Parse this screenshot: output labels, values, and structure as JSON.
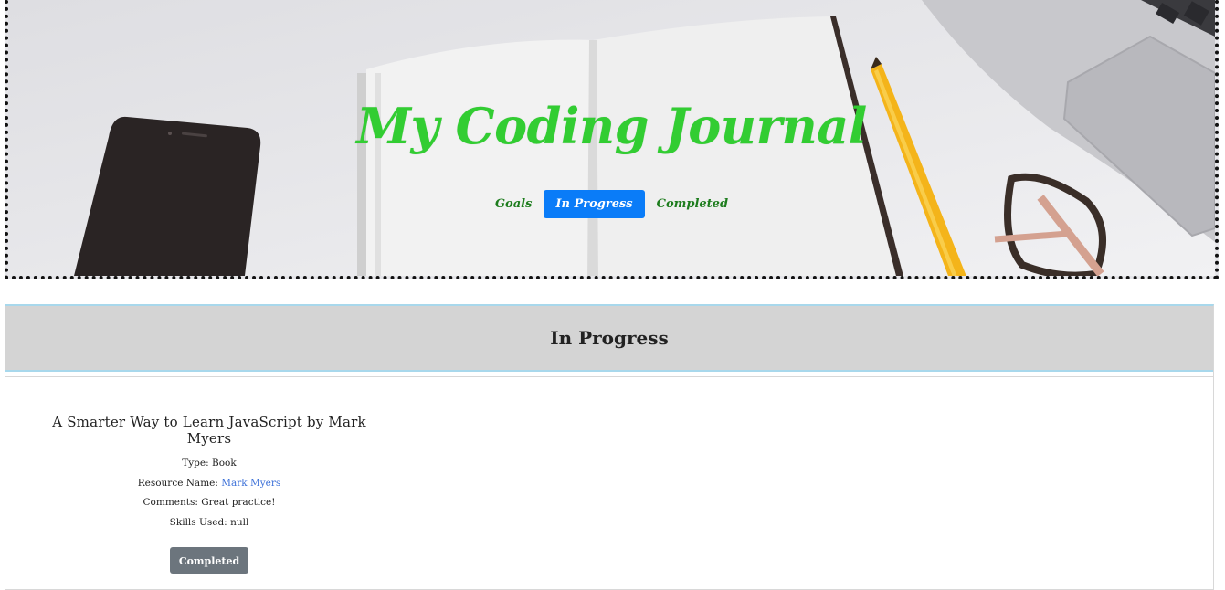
{
  "header": {
    "title": "My Coding Journal",
    "nav": [
      {
        "label": "Goals",
        "active": false
      },
      {
        "label": "In Progress",
        "active": true
      },
      {
        "label": "Completed",
        "active": false
      }
    ]
  },
  "section": {
    "title": "In Progress",
    "items": [
      {
        "title": "A Smarter Way to Learn JavaScript by Mark Myers",
        "type_label": "Type:",
        "type": "Book",
        "resource_label": "Resource Name:",
        "resource_name": "Mark Myers",
        "comments_label": "Comments:",
        "comments": "Great practice!",
        "skills_label": "Skills Used:",
        "skills": "null",
        "button_label": "Completed"
      }
    ]
  },
  "colors": {
    "title_green": "#32cd32",
    "nav_green": "#1e7d1e",
    "active_blue": "#0a7cf8",
    "button_gray": "#6c757d",
    "link_blue": "#3a6fd8"
  }
}
